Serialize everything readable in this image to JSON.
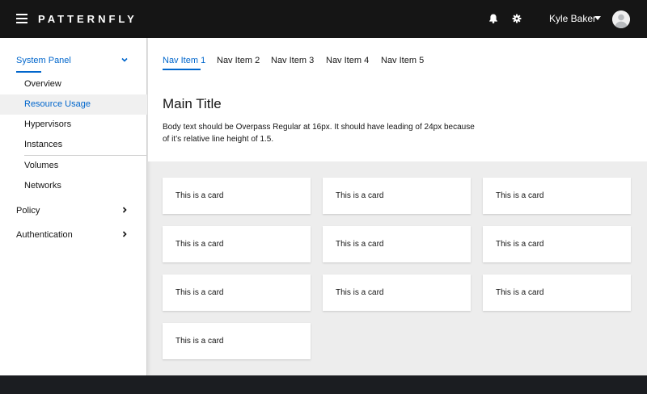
{
  "masthead": {
    "brand": "PATTERNFLY",
    "user_name": "Kyle Baker"
  },
  "sidebar": {
    "groups": [
      {
        "label": "System Panel",
        "expanded": true
      },
      {
        "label": "Policy",
        "expanded": false
      },
      {
        "label": "Authentication",
        "expanded": false
      }
    ],
    "sub_items": [
      {
        "label": "Overview"
      },
      {
        "label": "Resource Usage"
      },
      {
        "label": "Hypervisors"
      },
      {
        "label": "Instances"
      },
      {
        "label": "Volumes"
      },
      {
        "label": "Networks"
      }
    ],
    "current_item": "Resource Usage"
  },
  "topnav": {
    "items": [
      {
        "label": "Nav Item 1"
      },
      {
        "label": "Nav Item 2"
      },
      {
        "label": "Nav Item 3"
      },
      {
        "label": "Nav Item 4"
      },
      {
        "label": "Nav Item 5"
      }
    ],
    "current_item": "Nav Item 1"
  },
  "main": {
    "title": "Main Title",
    "body": "Body text should be Overpass Regular at 16px. It should have leading of 24px because of it’s relative line height of 1.5."
  },
  "cards": [
    {
      "label": "This is a card"
    },
    {
      "label": "This is a card"
    },
    {
      "label": "This is a card"
    },
    {
      "label": "This is a card"
    },
    {
      "label": "This is a card"
    },
    {
      "label": "This is a card"
    },
    {
      "label": "This is a card"
    },
    {
      "label": "This is a card"
    },
    {
      "label": "This is a card"
    },
    {
      "label": "This is a card"
    }
  ],
  "colors": {
    "masthead_bg": "#151515",
    "accent": "#0066cc",
    "page_bg": "#ededed"
  },
  "icons": {
    "menu": "hamburger-icon",
    "notifications": "bell-icon",
    "settings": "gear-icon",
    "user_menu": "caret-down-icon",
    "avatar": "avatar-icon"
  }
}
